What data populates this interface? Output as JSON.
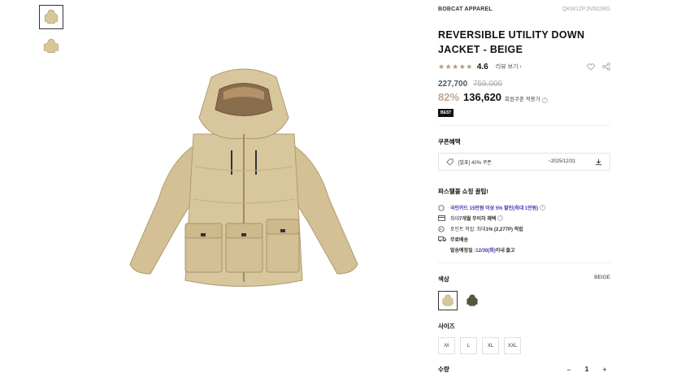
{
  "product": {
    "brand": "BOBCAT APPAREL",
    "code": "QKW12PJN502BG",
    "title_line1": "REVERSIBLE UTILITY DOWN",
    "title_line2": "JACKET - BEIGE",
    "stars": "★★★★★",
    "rating": "4.6",
    "review_link": "리뷰 보기 ›",
    "original_price": "227,700",
    "list_price": "759,000",
    "discount": "82%",
    "sale_price": "136,620",
    "member_coupon_note": "회원쿠폰 적용가",
    "badge": "BEST"
  },
  "coupon": {
    "section_title": "쿠폰혜택",
    "name": "[발표] 40% 쿠폰",
    "period": "~2025/12/31"
  },
  "tips": {
    "section_title": "파스텔몰 쇼핑 꿀팁!",
    "card": "국민카드 15만원 이상 5% 할인(최대 1만원)",
    "installment_prefix": "최대 ",
    "installment_bold": "7개월 무이자 혜택",
    "points_prefix": "포인트 적립: 최대 ",
    "points_bold": "1% (2,277P) 적립",
    "shipping": "무료배송",
    "eta_prefix": "발송예정일 : ",
    "eta_date": "12/30(화)",
    "eta_suffix": " 이내 출고"
  },
  "color": {
    "label": "색상",
    "selected": "BEIGE",
    "swatches": [
      "beige",
      "khaki"
    ]
  },
  "size": {
    "label": "사이즈",
    "options": [
      "M",
      "L",
      "XL",
      "XXL"
    ]
  },
  "quantity": {
    "label": "수량",
    "value": "1",
    "minus": "−",
    "plus": "+"
  },
  "colors": {
    "jacket": "#d8c69c",
    "accent_tan": "#c0a68a",
    "purple": "#4a2fb0"
  }
}
